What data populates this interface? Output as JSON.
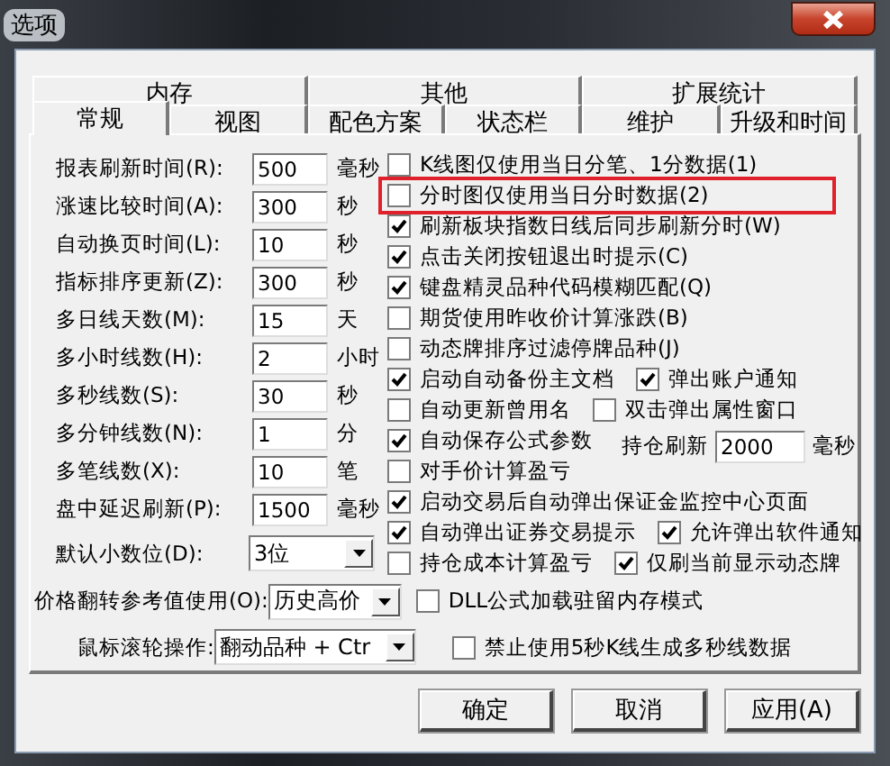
{
  "window": {
    "title": "选项"
  },
  "tabs": [
    [
      {
        "label": "内存",
        "selected": false
      },
      {
        "label": "其他",
        "selected": false
      },
      {
        "label": "扩展统计",
        "selected": false
      }
    ],
    [
      {
        "label": "常规",
        "selected": true
      },
      {
        "label": "视图",
        "selected": false
      },
      {
        "label": "配色方案",
        "selected": false
      },
      {
        "label": "状态栏",
        "selected": false
      },
      {
        "label": "维护",
        "selected": false
      },
      {
        "label": "升级和时间",
        "selected": false
      }
    ]
  ],
  "settings": [
    {
      "label": "报表刷新时间(R):",
      "value": "500",
      "unit": "毫秒"
    },
    {
      "label": "涨速比较时间(A):",
      "value": "300",
      "unit": "秒"
    },
    {
      "label": "自动换页时间(L):",
      "value": "10",
      "unit": "秒"
    },
    {
      "label": "指标排序更新(Z):",
      "value": "300",
      "unit": "秒"
    },
    {
      "label": "多日线天数(M):",
      "value": "15",
      "unit": "天"
    },
    {
      "label": "多小时线数(H):",
      "value": "2",
      "unit": "小时"
    },
    {
      "label": "多秒线数(S):",
      "value": "30",
      "unit": "秒"
    },
    {
      "label": "多分钟线数(N):",
      "value": "1",
      "unit": "分"
    },
    {
      "label": "多笔线数(X):",
      "value": "10",
      "unit": "笔"
    },
    {
      "label": "盘中延迟刷新(P):",
      "value": "1500",
      "unit": "毫秒"
    }
  ],
  "decimals": {
    "label": "默认小数位(D):",
    "value": "3位"
  },
  "options": [
    [
      {
        "kind": "checkbox",
        "label": "K线图仅使用当日分笔、1分数据(1)",
        "checked": false,
        "highlighted": false
      }
    ],
    [
      {
        "kind": "checkbox",
        "label": "分时图仅使用当日分时数据(2)",
        "checked": false,
        "highlighted": true
      }
    ],
    [
      {
        "kind": "checkbox",
        "label": "刷新板块指数日线后同步刷新分时(W)",
        "checked": true,
        "highlighted": false
      }
    ],
    [
      {
        "kind": "checkbox",
        "label": "点击关闭按钮退出时提示(C)",
        "checked": true,
        "highlighted": false
      }
    ],
    [
      {
        "kind": "checkbox",
        "label": "键盘精灵品种代码模糊匹配(Q)",
        "checked": true,
        "highlighted": false
      }
    ],
    [
      {
        "kind": "checkbox",
        "label": "期货使用昨收价计算涨跌(B)",
        "checked": false,
        "highlighted": false
      }
    ],
    [
      {
        "kind": "checkbox",
        "label": "动态牌排序过滤停牌品种(J)",
        "checked": false,
        "highlighted": false
      }
    ],
    [
      {
        "kind": "checkbox",
        "label": "启动自动备份主文档",
        "checked": true,
        "highlighted": false
      },
      {
        "kind": "checkbox",
        "label": "弹出账户通知",
        "checked": true,
        "highlighted": false
      }
    ],
    [
      {
        "kind": "checkbox",
        "label": "自动更新曾用名",
        "checked": false,
        "highlighted": false
      },
      {
        "kind": "checkbox",
        "label": "双击弹出属性窗口",
        "checked": false,
        "highlighted": false
      }
    ],
    [
      {
        "kind": "checkbox",
        "label": "自动保存公式参数",
        "checked": true,
        "highlighted": false
      },
      {
        "kind": "number",
        "label": "持仓刷新",
        "value": "2000",
        "unit": "毫秒"
      }
    ],
    [
      {
        "kind": "checkbox",
        "label": "对手价计算盈亏",
        "checked": false,
        "highlighted": false
      }
    ],
    [
      {
        "kind": "checkbox",
        "label": "启动交易后自动弹出保证金监控中心页面",
        "checked": true,
        "highlighted": false
      }
    ],
    [
      {
        "kind": "checkbox",
        "label": "自动弹出证券交易提示",
        "checked": true,
        "highlighted": false
      },
      {
        "kind": "checkbox",
        "label": "允许弹出软件通知",
        "checked": true,
        "highlighted": false
      }
    ],
    [
      {
        "kind": "checkbox",
        "label": "持仓成本计算盈亏",
        "checked": false,
        "highlighted": false
      },
      {
        "kind": "checkbox",
        "label": "仅刷当前显示动态牌",
        "checked": true,
        "highlighted": false
      }
    ]
  ],
  "bottom": [
    {
      "select": {
        "label": "价格翻转参考值使用(O):",
        "value": "历史高价"
      },
      "option": {
        "label": "DLL公式加载驻留内存模式",
        "checked": false
      }
    },
    {
      "select": {
        "label": "鼠标滚轮操作:",
        "value": "翻动品种 + Ctr"
      },
      "option": {
        "label": "禁止使用5秒K线生成多秒线数据",
        "checked": false
      }
    }
  ],
  "buttons": [
    "确定",
    "取消",
    "应用(A)"
  ]
}
